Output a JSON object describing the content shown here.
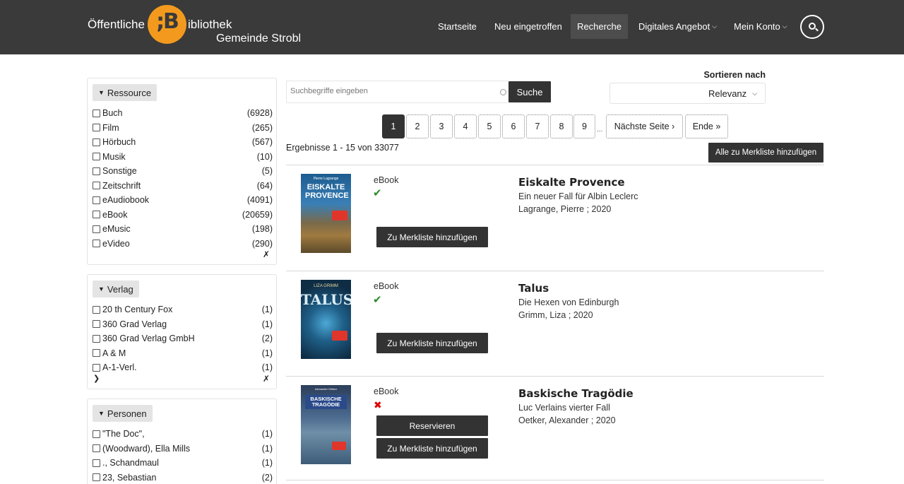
{
  "header": {
    "logo_left": "Öffentliche",
    "logo_mark": ";B",
    "logo_right": "ibliothek",
    "logo_sub": "Gemeinde Strobl",
    "nav": [
      {
        "label": "Startseite"
      },
      {
        "label": "Neu eingetroffen"
      },
      {
        "label": "Recherche"
      },
      {
        "label": "Digitales Angebot"
      },
      {
        "label": "Mein Konto"
      }
    ]
  },
  "search": {
    "placeholder": "Suchbegriffe eingeben",
    "button": "Suche"
  },
  "sort": {
    "label": "Sortieren nach",
    "value": "Relevanz"
  },
  "pagination": {
    "pages": [
      "1",
      "2",
      "3",
      "4",
      "5",
      "6",
      "7",
      "8",
      "9"
    ],
    "ellipsis": "...",
    "next": "Nächste Seite ›",
    "end": "Ende »"
  },
  "results_info": "Ergebnisse 1 - 15 von 33077",
  "add_all_label": "Alle zu Merkliste hinzufügen",
  "facets": [
    {
      "title": "Ressource",
      "items": [
        {
          "label": "Buch",
          "count": "(6928)"
        },
        {
          "label": "Film",
          "count": "(265)"
        },
        {
          "label": "Hörbuch",
          "count": "(567)"
        },
        {
          "label": "Musik",
          "count": "(10)"
        },
        {
          "label": "Sonstige",
          "count": "(5)"
        },
        {
          "label": "Zeitschrift",
          "count": "(64)"
        },
        {
          "label": "eAudiobook",
          "count": "(4091)"
        },
        {
          "label": "eBook",
          "count": "(20659)"
        },
        {
          "label": "eMusic",
          "count": "(198)"
        },
        {
          "label": "eVideo",
          "count": "(290)"
        }
      ]
    },
    {
      "title": "Verlag",
      "items": [
        {
          "label": "20 th Century Fox",
          "count": "(1)"
        },
        {
          "label": "360 Grad Verlag",
          "count": "(1)"
        },
        {
          "label": "360 Grad Verlag GmbH",
          "count": "(2)"
        },
        {
          "label": "A & M",
          "count": "(1)"
        },
        {
          "label": "A-1-Verl.",
          "count": "(1)"
        }
      ]
    },
    {
      "title": "Personen",
      "items": [
        {
          "label": "\"The Doc\",",
          "count": "(1)"
        },
        {
          "label": "(Woodward), Ella Mills",
          "count": "(1)"
        },
        {
          "label": "., Schandmaul",
          "count": "(1)"
        },
        {
          "label": "23, Sebastian",
          "count": "(2)"
        }
      ]
    }
  ],
  "results": [
    {
      "media_type": "eBook",
      "available": true,
      "title": "Eiskalte Provence",
      "subtitle": "Ein neuer Fall für Albin Leclerc",
      "author_year": "Lagrange, Pierre ; 2020",
      "cover_title": "EISKALTE PROVENCE",
      "cover_author": "Pierre Lagrange",
      "reserve_label": "",
      "merk_label": "Zu Merkliste hinzufügen"
    },
    {
      "media_type": "eBook",
      "available": true,
      "title": "Talus",
      "subtitle": "Die Hexen von Edinburgh",
      "author_year": "Grimm, Liza ; 2020",
      "cover_title": "TALUS",
      "cover_author": "LIZA GRIMM",
      "reserve_label": "",
      "merk_label": "Zu Merkliste hinzufügen"
    },
    {
      "media_type": "eBook",
      "available": false,
      "title": "Baskische Tragödie",
      "subtitle": "Luc Verlains vierter Fall",
      "author_year": "Oetker, Alexander ; 2020",
      "cover_title": "BASKISCHE TRAGÖDIE",
      "cover_author": "Alexander Oetker",
      "reserve_label": "Reservieren",
      "merk_label": "Zu Merkliste hinzufügen"
    }
  ],
  "colors": {
    "header_bg": "#3a3a3a",
    "logo_accent": "#f39a1e",
    "button_dark": "#333333",
    "available": "#2a8a2a",
    "unavailable": "#e00000"
  }
}
